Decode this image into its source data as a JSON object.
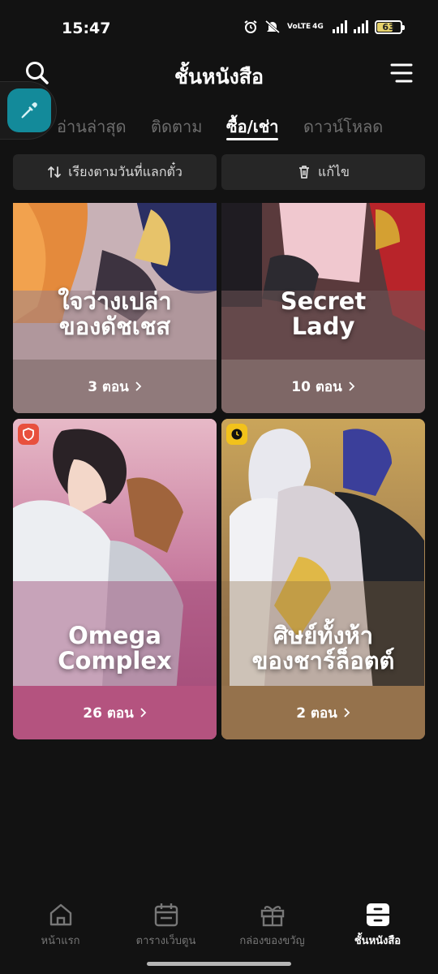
{
  "status": {
    "time": "15:47",
    "net_type": "VoLTE",
    "net_gen": "4G",
    "battery": "63"
  },
  "header": {
    "title": "ชั้นหนังสือ"
  },
  "tabs": [
    {
      "label": "อ่านล่าสุด"
    },
    {
      "label": "ติดตาม"
    },
    {
      "label": "ซื้อ/เช่า"
    },
    {
      "label": "ดาวน์โหลด"
    }
  ],
  "actions": {
    "sort_label": "เรียงตามวันที่แลกตั๋ว",
    "edit_label": "แก้ไข"
  },
  "books": [
    {
      "title_line1": "ใจว่างเปล่า",
      "title_line2": "ของดัชเชส",
      "episodes": "3 ตอน",
      "badge": ""
    },
    {
      "title_line1": "Secret",
      "title_line2": "Lady",
      "episodes": "10 ตอน",
      "badge": ""
    },
    {
      "title_line1": "Omega",
      "title_line2": "Complex",
      "episodes": "26 ตอน",
      "badge": "shield-icon"
    },
    {
      "title_line1": "ศิษย์ทั้งห้า",
      "title_line2": "ของชาร์ล็อตต์",
      "episodes": "2 ตอน",
      "badge": "clock-icon"
    }
  ],
  "bottom_nav": [
    {
      "label": "หน้าแรก",
      "icon": "home-icon"
    },
    {
      "label": "ตารางเว็บตูน",
      "icon": "calendar-icon"
    },
    {
      "label": "กล่องของขวัญ",
      "icon": "gift-icon"
    },
    {
      "label": "ชั้นหนังสือ",
      "icon": "bookshelf-icon",
      "active": true
    }
  ],
  "colors": {
    "background": "#121212",
    "accent_float": "#138a9a",
    "badge_red": "#e8503e",
    "badge_yellow": "#f2c21b"
  }
}
